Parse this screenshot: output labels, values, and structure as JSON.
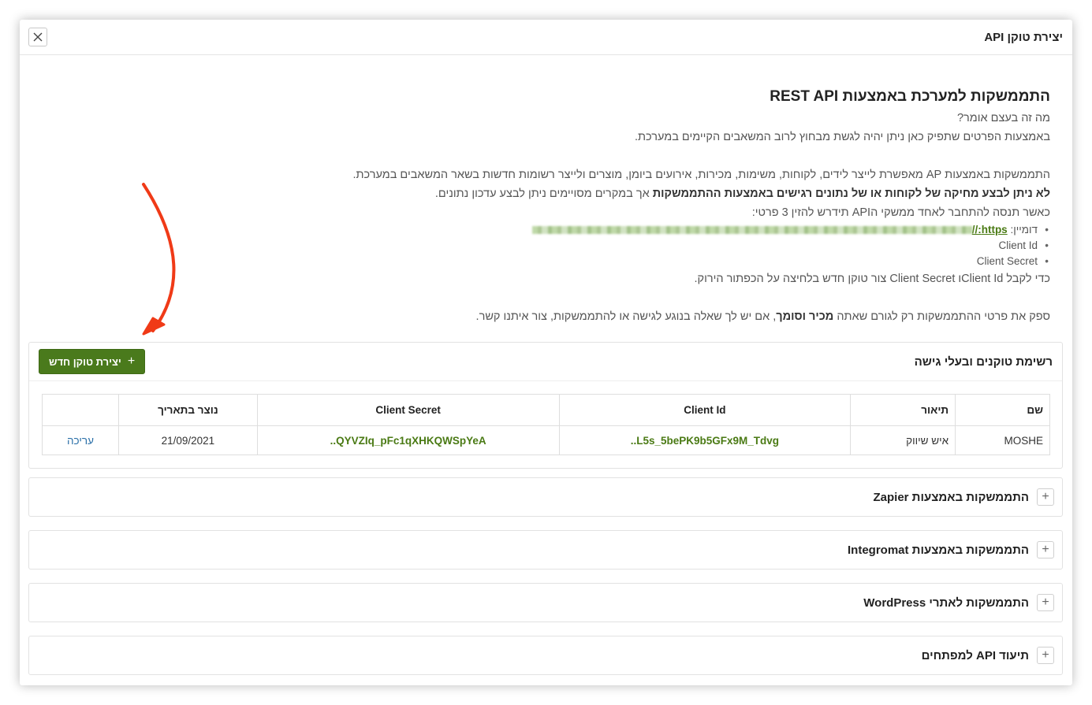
{
  "modal": {
    "title": "יצירת טוקן API"
  },
  "intro": {
    "heading": "התממשקות למערכת באמצעות REST API",
    "q": "מה זה בעצם אומר?",
    "p1": "באמצעות הפרטים שתפיק כאן ניתן יהיה לגשת מבחוץ לרוב המשאבים הקיימים במערכת.",
    "p2": "התממשקות באמצעות AP מאפשרת לייצר לידים, לקוחות, משימות, מכירות, אירועים ביומן, מוצרים ולייצר רשומות חדשות בשאר המשאבים במערכת.",
    "p3_bold": "לא ניתן לבצע מחיקה של לקוחות או של נתונים רגישים באמצעות ההתממשקות",
    "p3_rest": " אך במקרים מסויימים ניתן לבצע עדכון נתונים.",
    "p4": "כאשר תנסה להתחבר לאחד ממשקי הAPI תידרש להזין 3 פרטי:",
    "domain_label": "דומיין: ",
    "domain_link": "https://",
    "client_id": "Client Id",
    "client_secret": "Client Secret",
    "p5": "כדי לקבל Client Idו Client Secret צור טוקן חדש בלחיצה על הכפתור הירוק.",
    "p6_a": "ספק את פרטי ההתממשקות רק לגורם שאתה ",
    "p6_bold": "מכיר וסומך",
    "p6_b": ", אם יש לך שאלה בנוגע לגישה או להתממשקות, צור איתנו קשר."
  },
  "tokens": {
    "title": "רשימת טוקנים ובעלי גישה",
    "new_button": "יצירת טוקן חדש",
    "columns": [
      "שם",
      "תיאור",
      "Client Id",
      "Client Secret",
      "נוצר בתאריך",
      ""
    ],
    "rows": [
      {
        "name": "MOSHE",
        "description": "איש שיווק",
        "client_id": "..L5s_5bePK9b5GFx9M_Tdvg",
        "client_secret": "..QYVZIq_pFc1qXHKQWSpYeA",
        "created": "21/09/2021",
        "action": "עריכה"
      }
    ]
  },
  "accordions": [
    "התממשקות באמצעות Zapier",
    "התממשקות באמצעות Integromat",
    "התממשקות לאתרי WordPress",
    "תיעוד API למפתחים"
  ],
  "colors": {
    "accent_green": "#4a7a1c",
    "arrow_red": "#f03a17",
    "link_blue": "#2a6fa8"
  }
}
